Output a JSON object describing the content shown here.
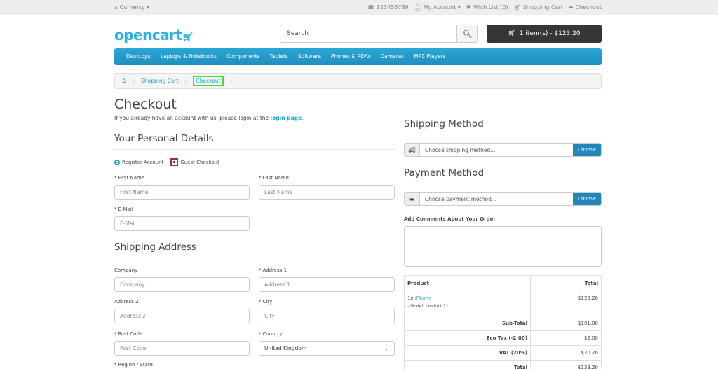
{
  "topbar": {
    "currency": "$ Currency ▾",
    "phone": "123456789",
    "my_account": "My Account ▾",
    "wishlist": "Wish List (0)",
    "shopping_cart": "Shopping Cart",
    "checkout": "Checkout"
  },
  "header": {
    "logo": "opencart",
    "search_placeholder": "Search",
    "cart_button": "1 item(s) - $123.20"
  },
  "menu": [
    "Desktops",
    "Laptops & Notebooks",
    "Components",
    "Tablets",
    "Software",
    "Phones & PDAs",
    "Cameras",
    "MP3 Players"
  ],
  "breadcrumb": {
    "shopping_cart": "Shopping Cart",
    "checkout": "Checkout"
  },
  "page": {
    "title": "Checkout",
    "intro_text": "If you already have an account with us, please login at the",
    "intro_link": "login page",
    "intro_end": "."
  },
  "personal": {
    "heading": "Your Personal Details",
    "register": "Register Account",
    "guest": "Guest Checkout",
    "first_name_label": "First Name",
    "first_name_ph": "First Name",
    "last_name_label": "Last Name",
    "last_name_ph": "Last Name",
    "email_label": "E-Mail",
    "email_ph": "E-Mail"
  },
  "shipping_address": {
    "heading": "Shipping Address",
    "company_label": "Company",
    "company_ph": "Company",
    "address1_label": "Address 1",
    "address1_ph": "Address 1",
    "address2_label": "Address 2",
    "address2_ph": "Address 2",
    "city_label": "City",
    "city_ph": "City",
    "postcode_label": "Post Code",
    "postcode_ph": "Post Code",
    "country_label": "Country",
    "country_value": "United Kingdom",
    "region_label": "Region / State"
  },
  "shipping_method": {
    "heading": "Shipping Method",
    "placeholder": "Choose shipping method...",
    "button": "Choose"
  },
  "payment_method": {
    "heading": "Payment Method",
    "placeholder": "Choose payment method...",
    "button": "Choose"
  },
  "comments": {
    "label": "Add Comments About Your Order"
  },
  "order": {
    "col_product": "Product",
    "col_total": "Total",
    "item_qty": "1x",
    "item_name": "iPhone",
    "item_model": "- Model: product 11",
    "item_total": "$123.20",
    "subtotal_label": "Sub-Total",
    "subtotal_value": "$101.00",
    "ecotax_label": "Eco Tax (-2.00)",
    "ecotax_value": "$2.00",
    "vat_label": "VAT (20%)",
    "vat_value": "$20.20",
    "total_label": "Total",
    "total_value": "$123.20"
  }
}
